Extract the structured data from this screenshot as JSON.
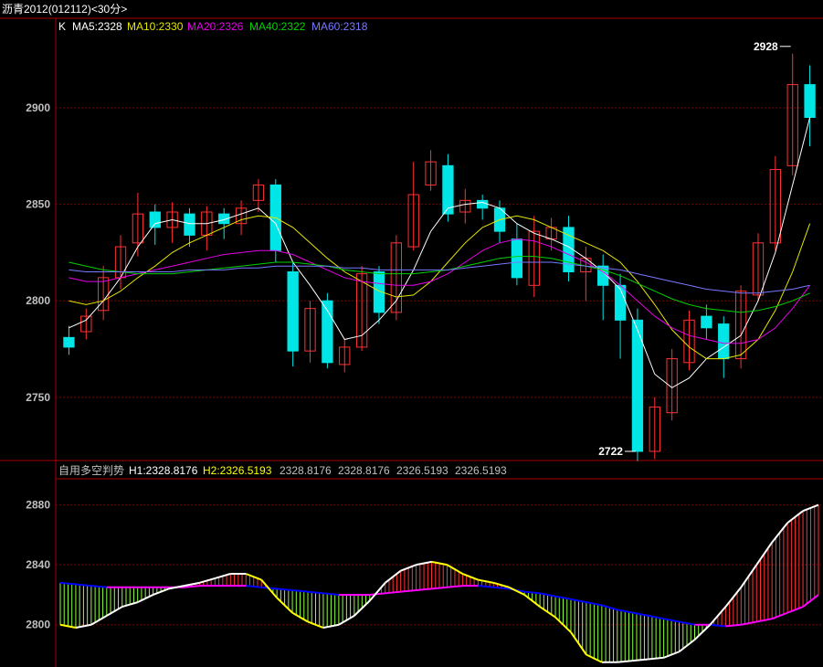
{
  "window": {
    "title": "沥青2012(012112)<30分>"
  },
  "colors": {
    "up": "#ff3232",
    "down": "#00e6e6",
    "grid": "#7a0000",
    "frame": "#a80000",
    "axis_text": "#c0c0c0",
    "ma5": "#ffffff",
    "ma10": "#e6e600",
    "ma20": "#e600e6",
    "ma40": "#00d200",
    "ma60": "#7878ff",
    "h_white": "#ffffff",
    "h_yellow": "#ffff00",
    "l_magenta": "#ff00ff",
    "l_blue": "#0000ff",
    "bar_red": "#ff3232",
    "bar_green": "#8cff3c"
  },
  "main_legend": {
    "k": "K",
    "ma5": "MA5:2328",
    "ma10": "MA10:2330",
    "ma20": "MA20:2326",
    "ma40": "MA40:2322",
    "ma60": "MA60:2318"
  },
  "sub_legend": {
    "name": "自用多空判势",
    "h1": "H1:2328.8176",
    "h2": "H2:2326.5193",
    "v1": "2328.8176",
    "v2": "2328.8176",
    "v3": "2326.5193",
    "v4": "2326.5193"
  },
  "chart_data": [
    {
      "type": "candlestick",
      "y_ticks": [
        2750,
        2800,
        2850,
        2900
      ],
      "ylim": [
        2722,
        2935
      ],
      "annotations": [
        {
          "text": "2928",
          "index": 42,
          "value": 2928
        },
        {
          "text": "2722",
          "index": 33,
          "value": 2722
        }
      ],
      "candles": [
        [
          2781,
          2776,
          2787,
          2772
        ],
        [
          2784,
          2792,
          2796,
          2780
        ],
        [
          2795,
          2812,
          2818,
          2790
        ],
        [
          2812,
          2828,
          2834,
          2806
        ],
        [
          2830,
          2845,
          2856,
          2823
        ],
        [
          2846,
          2838,
          2850,
          2829
        ],
        [
          2838,
          2846,
          2851,
          2830
        ],
        [
          2845,
          2834,
          2848,
          2828
        ],
        [
          2834,
          2846,
          2849,
          2826
        ],
        [
          2845,
          2840,
          2848,
          2832
        ],
        [
          2840,
          2848,
          2852,
          2834
        ],
        [
          2852,
          2860,
          2863,
          2846
        ],
        [
          2860,
          2826,
          2863,
          2820
        ],
        [
          2815,
          2774,
          2820,
          2766
        ],
        [
          2774,
          2796,
          2800,
          2768
        ],
        [
          2800,
          2768,
          2804,
          2765
        ],
        [
          2767,
          2776,
          2780,
          2763
        ],
        [
          2776,
          2814,
          2818,
          2774
        ],
        [
          2815,
          2794,
          2818,
          2788
        ],
        [
          2794,
          2830,
          2834,
          2790
        ],
        [
          2828,
          2855,
          2872,
          2826
        ],
        [
          2860,
          2872,
          2878,
          2857
        ],
        [
          2870,
          2845,
          2876,
          2841
        ],
        [
          2846,
          2852,
          2858,
          2840
        ],
        [
          2852,
          2848,
          2855,
          2842
        ],
        [
          2848,
          2836,
          2852,
          2830
        ],
        [
          2832,
          2812,
          2840,
          2808
        ],
        [
          2808,
          2836,
          2844,
          2802
        ],
        [
          2832,
          2838,
          2843,
          2826
        ],
        [
          2838,
          2815,
          2844,
          2810
        ],
        [
          2815,
          2822,
          2828,
          2800
        ],
        [
          2818,
          2808,
          2824,
          2790
        ],
        [
          2808,
          2790,
          2814,
          2770
        ],
        [
          2790,
          2722,
          2796,
          2717
        ],
        [
          2722,
          2745,
          2750,
          2718
        ],
        [
          2742,
          2770,
          2775,
          2738
        ],
        [
          2768,
          2790,
          2795,
          2764
        ],
        [
          2792,
          2786,
          2798,
          2780
        ],
        [
          2788,
          2770,
          2792,
          2760
        ],
        [
          2770,
          2805,
          2808,
          2765
        ],
        [
          2803,
          2830,
          2835,
          2800
        ],
        [
          2830,
          2868,
          2875,
          2826
        ],
        [
          2870,
          2912,
          2928,
          2865
        ],
        [
          2912,
          2895,
          2922,
          2880
        ]
      ],
      "ma5": [
        2786,
        2790,
        2800,
        2812,
        2828,
        2840,
        2842,
        2840,
        2840,
        2842,
        2845,
        2848,
        2840,
        2820,
        2808,
        2795,
        2780,
        2782,
        2790,
        2800,
        2816,
        2836,
        2848,
        2850,
        2851,
        2848,
        2840,
        2835,
        2832,
        2828,
        2822,
        2815,
        2806,
        2785,
        2762,
        2755,
        2760,
        2770,
        2776,
        2782,
        2800,
        2825,
        2860,
        2895
      ],
      "ma10": [
        2800,
        2798,
        2800,
        2805,
        2812,
        2818,
        2825,
        2830,
        2834,
        2838,
        2842,
        2844,
        2843,
        2838,
        2830,
        2822,
        2815,
        2810,
        2805,
        2802,
        2803,
        2810,
        2820,
        2830,
        2838,
        2842,
        2844,
        2842,
        2838,
        2834,
        2830,
        2826,
        2820,
        2810,
        2798,
        2785,
        2776,
        2770,
        2770,
        2772,
        2780,
        2795,
        2815,
        2840
      ],
      "ma20": [
        2812,
        2810,
        2810,
        2812,
        2814,
        2816,
        2818,
        2820,
        2822,
        2824,
        2825,
        2826,
        2826,
        2824,
        2820,
        2816,
        2812,
        2810,
        2809,
        2808,
        2808,
        2810,
        2814,
        2820,
        2826,
        2830,
        2832,
        2831,
        2828,
        2824,
        2820,
        2815,
        2808,
        2800,
        2792,
        2786,
        2782,
        2780,
        2778,
        2778,
        2780,
        2786,
        2796,
        2808
      ],
      "ma40": [
        2820,
        2818,
        2816,
        2815,
        2814,
        2814,
        2814,
        2815,
        2816,
        2817,
        2818,
        2819,
        2820,
        2820,
        2819,
        2818,
        2816,
        2815,
        2814,
        2814,
        2814,
        2815,
        2816,
        2818,
        2820,
        2822,
        2823,
        2823,
        2822,
        2820,
        2818,
        2816,
        2813,
        2809,
        2805,
        2801,
        2798,
        2796,
        2795,
        2794,
        2795,
        2797,
        2800,
        2804
      ],
      "ma60": [
        2816,
        2815,
        2815,
        2815,
        2815,
        2815,
        2815,
        2816,
        2816,
        2816,
        2817,
        2817,
        2818,
        2818,
        2818,
        2818,
        2817,
        2817,
        2816,
        2816,
        2816,
        2816,
        2816,
        2817,
        2818,
        2819,
        2820,
        2820,
        2820,
        2819,
        2818,
        2817,
        2816,
        2814,
        2812,
        2810,
        2808,
        2806,
        2805,
        2804,
        2804,
        2805,
        2806,
        2808
      ]
    },
    {
      "type": "line",
      "name": "自用多空判势",
      "y_ticks": [
        2800,
        2840,
        2880
      ],
      "ylim": [
        2773,
        2895
      ],
      "h": [
        2800,
        2798,
        2800,
        2806,
        2812,
        2815,
        2820,
        2824,
        2826,
        2828,
        2831,
        2834,
        2834,
        2830,
        2818,
        2808,
        2802,
        2798,
        2800,
        2806,
        2816,
        2828,
        2836,
        2840,
        2842,
        2840,
        2834,
        2830,
        2828,
        2825,
        2820,
        2812,
        2805,
        2795,
        2780,
        2775,
        2775,
        2776,
        2777,
        2778,
        2782,
        2790,
        2800,
        2812,
        2825,
        2840,
        2855,
        2868,
        2876,
        2880
      ],
      "l": [
        2828,
        2827,
        2826,
        2825,
        2825,
        2825,
        2825,
        2825,
        2825,
        2826,
        2826,
        2826,
        2826,
        2825,
        2824,
        2823,
        2822,
        2821,
        2820,
        2820,
        2820,
        2821,
        2822,
        2823,
        2824,
        2825,
        2826,
        2826,
        2825,
        2824,
        2822,
        2821,
        2819,
        2817,
        2815,
        2813,
        2810,
        2808,
        2806,
        2804,
        2802,
        2800,
        2800,
        2799,
        2800,
        2802,
        2804,
        2808,
        2812,
        2820
      ]
    }
  ]
}
